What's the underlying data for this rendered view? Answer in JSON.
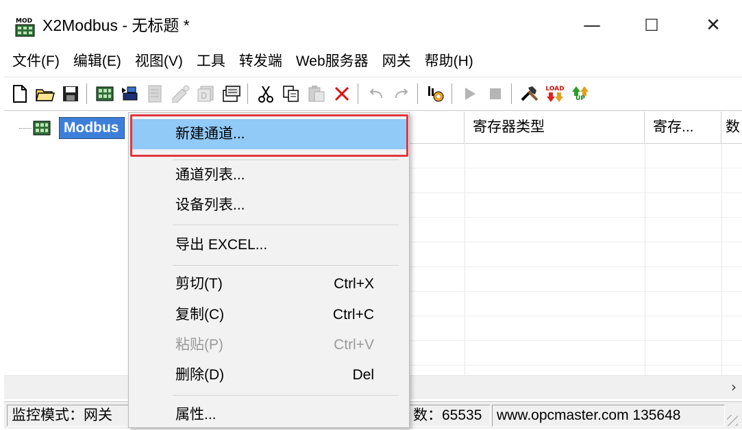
{
  "window": {
    "title": "X2Modbus - 无标题 *"
  },
  "title_buttons": [
    "—",
    "☐",
    "✕"
  ],
  "menubar": [
    "文件(F)",
    "编辑(E)",
    "视图(V)",
    "工具",
    "转发端",
    "Web服务器",
    "网关",
    "帮助(H)"
  ],
  "toolbar": {
    "icons": [
      "new-file-icon",
      "open-folder-icon",
      "save-icon",
      "channel-icon",
      "device-icon",
      "device-list-icon",
      "add-tag-icon",
      "batch-tag-icon",
      "properties-icon",
      "cut-icon",
      "copy-icon",
      "paste-icon",
      "delete-icon",
      "undo-icon",
      "redo-icon",
      "settings-run-icon",
      "start-icon",
      "stop-icon",
      "tools-icon",
      "load-icon",
      "upload-icon"
    ],
    "load_text": "LOAD",
    "up_text": "UP"
  },
  "tree": {
    "root_label": "Modbus"
  },
  "listview": {
    "columns": [
      "寄存器类型",
      "寄存...",
      "数"
    ]
  },
  "statusbar": {
    "panel1": "监控模式：网关",
    "panel2": "数：65535",
    "panel3": "www.opcmaster.com 135648"
  },
  "context_menu": {
    "items": [
      {
        "label": "新建通道...",
        "shortcut": "",
        "highlighted": true,
        "disabled": false
      },
      {
        "label": "通道列表...",
        "shortcut": "",
        "highlighted": false,
        "disabled": false
      },
      {
        "label": "设备列表...",
        "shortcut": "",
        "highlighted": false,
        "disabled": false
      },
      {
        "label": "导出 EXCEL...",
        "shortcut": "",
        "highlighted": false,
        "disabled": false
      },
      {
        "label": "剪切(T)",
        "shortcut": "Ctrl+X",
        "highlighted": false,
        "disabled": false
      },
      {
        "label": "复制(C)",
        "shortcut": "Ctrl+C",
        "highlighted": false,
        "disabled": false
      },
      {
        "label": "粘贴(P)",
        "shortcut": "Ctrl+V",
        "highlighted": false,
        "disabled": true
      },
      {
        "label": "删除(D)",
        "shortcut": "Del",
        "highlighted": false,
        "disabled": false
      },
      {
        "label": "属性...",
        "shortcut": "",
        "highlighted": false,
        "disabled": false
      }
    ]
  },
  "colors": {
    "highlight": "#91c9f7",
    "annotation_box": "#e0363f",
    "tree_selection": "#3d7fd8"
  }
}
